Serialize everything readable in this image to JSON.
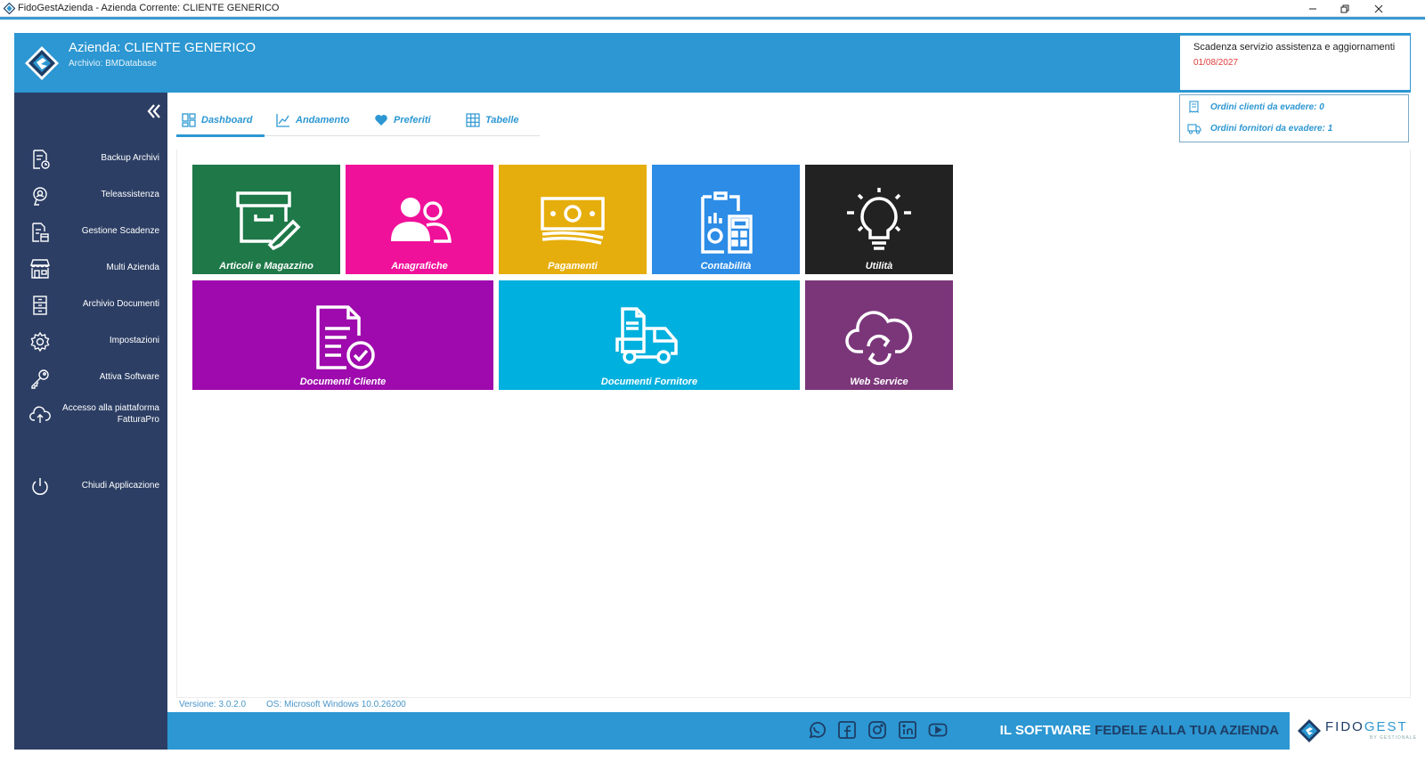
{
  "window": {
    "title": "FidoGestAzienda - Azienda Corrente: CLIENTE GENERICO"
  },
  "header": {
    "company": "Azienda: CLIENTE GENERICO",
    "archive": "Archivio: BMDatabase",
    "deadline_title": "Scadenza servizio assistenza e aggiornamenti",
    "deadline_date": "01/08/2027",
    "deadline_color": "#e03b3b"
  },
  "orders": {
    "clients": "Ordini clienti da evadere: 0",
    "suppliers": "Ordini fornitori da evadere: 1"
  },
  "sidebar": {
    "items": [
      {
        "label": "Backup Archivi",
        "icon": "backup-icon"
      },
      {
        "label": "Teleassistenza",
        "icon": "remote-assistance-icon"
      },
      {
        "label": "Gestione Scadenze",
        "icon": "deadlines-icon"
      },
      {
        "label": "Multi Azienda",
        "icon": "store-icon"
      },
      {
        "label": "Archivio Documenti",
        "icon": "archive-icon"
      },
      {
        "label": "Impostazioni",
        "icon": "gear-icon"
      },
      {
        "label": "Attiva Software",
        "icon": "key-icon"
      },
      {
        "label": "Accesso alla piattaforma FatturaPro",
        "icon": "cloud-upload-icon"
      },
      {
        "label": "Chiudi Applicazione",
        "icon": "power-icon"
      }
    ]
  },
  "tabs": [
    {
      "label": "Dashboard",
      "icon": "dashboard-icon",
      "active": true
    },
    {
      "label": "Andamento",
      "icon": "chart-line-icon"
    },
    {
      "label": "Preferiti",
      "icon": "heart-icon"
    },
    {
      "label": "Tabelle",
      "icon": "table-icon"
    }
  ],
  "tiles": [
    {
      "label": "Articoli e Magazzino",
      "color": "#1e7848",
      "icon": "box-icon"
    },
    {
      "label": "Anagrafiche",
      "color": "#f0119a",
      "icon": "users-icon"
    },
    {
      "label": "Pagamenti",
      "color": "#e6ae0c",
      "icon": "money-icon"
    },
    {
      "label": "Contabilità",
      "color": "#2c8ce6",
      "icon": "accounting-icon"
    },
    {
      "label": "Utilità",
      "color": "#222222",
      "icon": "lightbulb-icon"
    },
    {
      "label": "Documenti Cliente",
      "color": "#9e0aad",
      "icon": "document-check-icon"
    },
    {
      "label": "Documenti Fornitore",
      "color": "#00b0de",
      "icon": "truck-icon"
    },
    {
      "label": "Web Service",
      "color": "#7b367a",
      "icon": "cloud-sync-icon"
    }
  ],
  "status": {
    "version": "Versione: 3.0.2.0",
    "os": "OS: Microsoft Windows 10.0.26200"
  },
  "footer": {
    "slogan_part1": "IL SOFTWARE ",
    "slogan_part2": "FEDELE ALLA TUA AZIENDA",
    "logo_text1": "FIDO",
    "logo_text2": "GEST",
    "logo_sub": "BY GESTIONALE",
    "socials": [
      "whatsapp-icon",
      "facebook-icon",
      "instagram-icon",
      "linkedin-icon",
      "youtube-icon"
    ]
  },
  "colors": {
    "accent": "#2c97d2",
    "sidebar": "#2c3e64"
  }
}
